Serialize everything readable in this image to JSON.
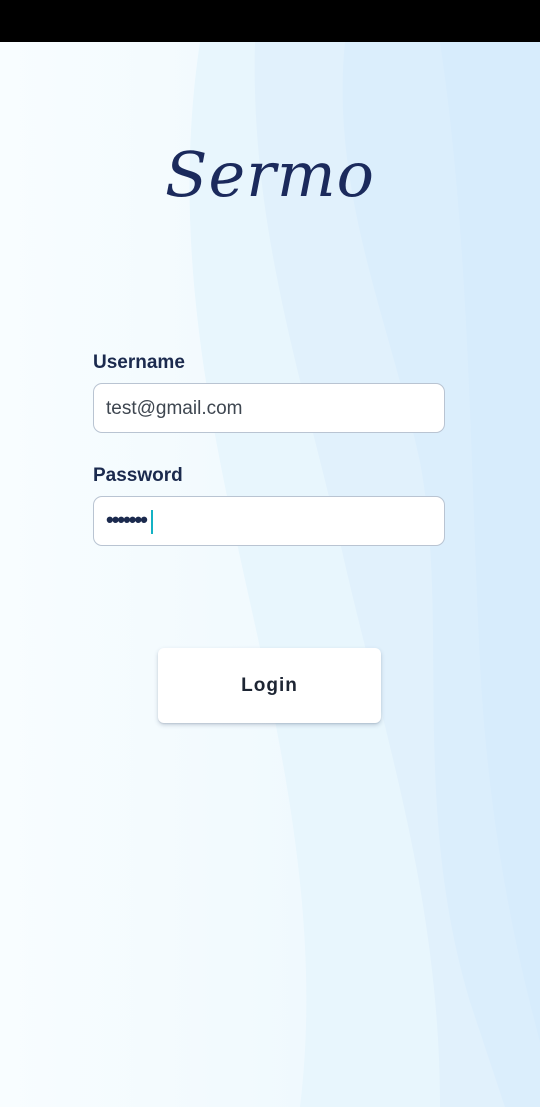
{
  "app": {
    "logo_text": "Sermo"
  },
  "form": {
    "username_label": "Username",
    "username_value": "test@gmail.com",
    "password_label": "Password",
    "password_masked": "•••••••",
    "login_label": "Login"
  },
  "colors": {
    "primary_text": "#1b2a4e",
    "logo": "#1b2a5c",
    "caret": "#14b2c4",
    "background": "#f4fbff"
  }
}
